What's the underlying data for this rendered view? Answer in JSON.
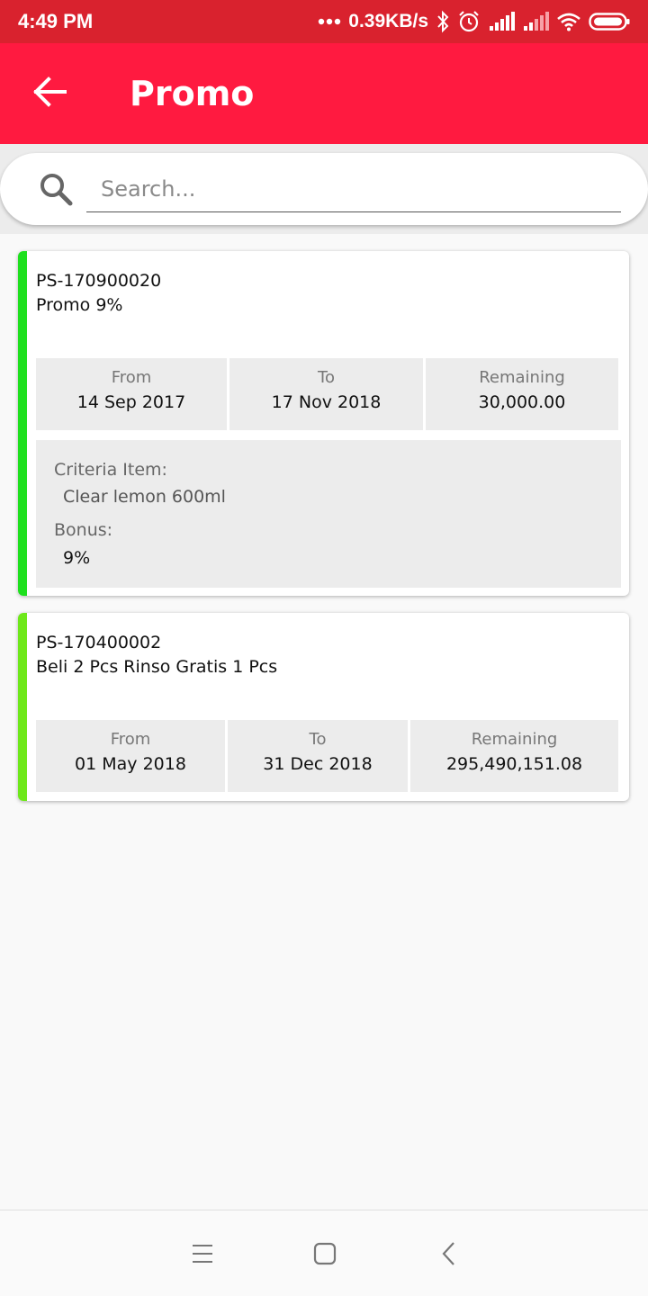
{
  "status_bar": {
    "time": "4:49 PM",
    "speed": "0.39KB/s",
    "icons": [
      "dots-icon",
      "bluetooth-icon",
      "alarm-icon",
      "signal-icon",
      "signal-icon",
      "wifi-icon",
      "battery-icon"
    ]
  },
  "app_bar": {
    "title": "Promo",
    "back_icon": "arrow-left-icon"
  },
  "search": {
    "placeholder": "Search...",
    "value": "",
    "icon": "search-icon"
  },
  "promos": [
    {
      "code": "PS-170900020",
      "name": "Promo 9%",
      "accent_color": "#1ee01e",
      "from_label": "From",
      "from": "14 Sep 2017",
      "to_label": "To",
      "to": "17 Nov 2018",
      "remaining_label": "Remaining",
      "remaining": "30,000.00",
      "criteria_label": "Criteria Item:",
      "criteria_item": "Clear lemon 600ml",
      "bonus_label": "Bonus:",
      "bonus": "9%"
    },
    {
      "code": "PS-170400002",
      "name": "Beli 2 Pcs Rinso Gratis 1 Pcs",
      "accent_color": "#6ee81a",
      "from_label": "From",
      "from": "01 May 2018",
      "to_label": "To",
      "to": "31 Dec 2018",
      "remaining_label": "Remaining",
      "remaining": "295,490,151.08"
    }
  ],
  "nav_bar": {
    "icons": [
      "menu-icon",
      "home-icon",
      "back-icon"
    ]
  },
  "colors": {
    "status_bar": "#d9222e",
    "app_bar": "#ff1a40",
    "card_cell": "#ececec"
  }
}
